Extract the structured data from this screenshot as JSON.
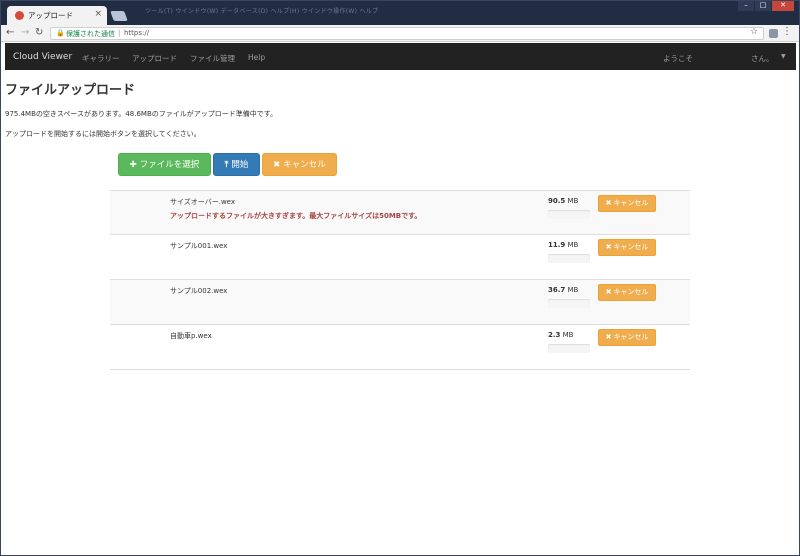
{
  "browser": {
    "tab_title": "アップロード",
    "tab_close": "×",
    "blurred_menu": "ツール(T)  ウインドウ(W)  データベース(D)  ヘルプ(H)  ウインドウ操作(W)  ヘルプ",
    "secure_label": "保護された通信",
    "url": "https://",
    "window_buttons": [
      "–",
      "□",
      "✕"
    ]
  },
  "navbar": {
    "brand": "Cloud Viewer",
    "links": [
      "ギャラリー",
      "アップロード",
      "ファイル管理",
      "Help"
    ],
    "welcome": "ようこそ",
    "user_suffix": "さん。"
  },
  "page": {
    "title": "ファイルアップロード",
    "space_info": "975.4MBの空きスペースがあります。48.6MBのファイルがアップロード準備中です。",
    "instruction": "アップロードを開始するには開始ボタンを選択してください。"
  },
  "buttons": {
    "select_file": "ファイルを選択",
    "start": "開始",
    "cancel": "キャンセル"
  },
  "uploads": [
    {
      "filename": "サイズオーバー.wex",
      "size_value": "90.5",
      "size_unit": "MB",
      "error": "アップロードするファイルが大きすぎます。最大ファイルサイズは50MBです。",
      "progress": 0,
      "cancel_label": "キャンセル"
    },
    {
      "filename": "サンプル001.wex",
      "size_value": "11.9",
      "size_unit": "MB",
      "error": "",
      "progress": 0,
      "cancel_label": "キャンセル"
    },
    {
      "filename": "サンプル002.wex",
      "size_value": "36.7",
      "size_unit": "MB",
      "error": "",
      "progress": 0,
      "cancel_label": "キャンセル"
    },
    {
      "filename": "自動車p.wex",
      "size_value": "2.3",
      "size_unit": "MB",
      "error": "",
      "progress": 0,
      "cancel_label": "キャンセル"
    }
  ],
  "colors": {
    "success": "#5cb85c",
    "primary": "#337ab7",
    "warning": "#f0ad4e",
    "danger_text": "#a94442",
    "navbar": "#222222"
  }
}
